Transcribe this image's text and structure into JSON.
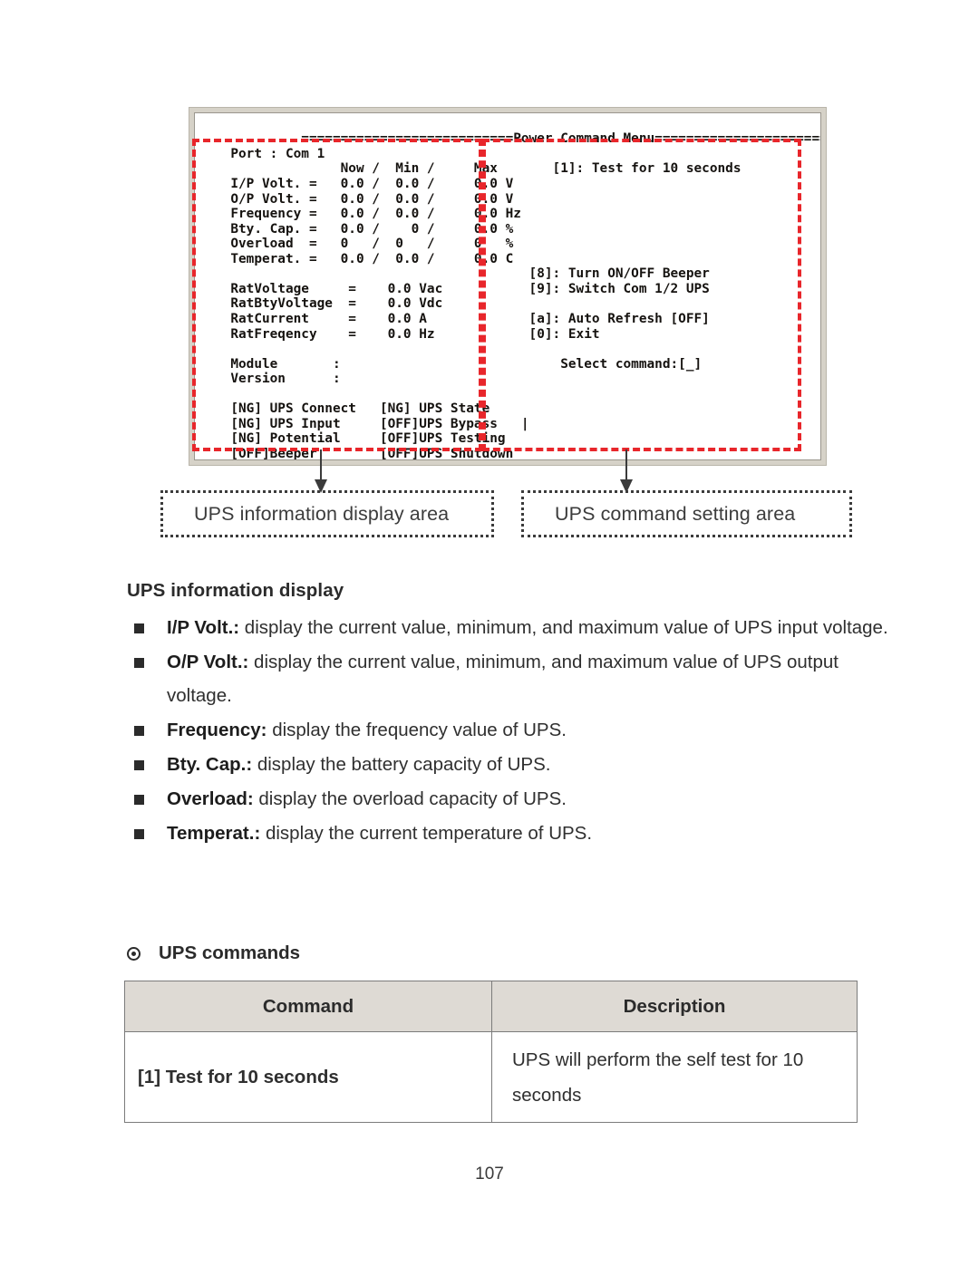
{
  "terminal": {
    "screen_text": "           ===========================Power Command Menu===========================\n  Port : Com 1\n                Now /  Min /     Max       [1]: Test for 10 seconds\n  I/P Volt. =   0.0 /  0.0 /     0.0 V\n  O/P Volt. =   0.0 /  0.0 /     0.0 V\n  Frequency =   0.0 /  0.0 /     0.0 Hz\n  Bty. Cap. =   0.0 /    0 /     0.0 %\n  Overload  =   0   /  0   /     0   %\n  Temperat. =   0.0 /  0.0 /     0.0 C\n                                        [8]: Turn ON/OFF Beeper\n  RatVoltage     =    0.0 Vac           [9]: Switch Com 1/2 UPS\n  RatBtyVoltage  =    0.0 Vdc\n  RatCurrent     =    0.0 A             [a]: Auto Refresh [OFF]\n  RatFreqency    =    0.0 Hz            [0]: Exit\n\n  Module       :                            Select command:[_]\n  Version      :\n\n  [NG] UPS Connect   [NG] UPS State\n  [NG] UPS Input     [OFF]UPS Bypass   |\n  [NG] Potential     [OFF]UPS Testing\n  [OFF]Beeper        [OFF]UPS Shutdown",
    "header_title": "Power Command Menu",
    "port_label": "Port : Com 1",
    "column_headers": [
      "Now",
      "Min",
      "Max"
    ],
    "readings": [
      {
        "label": "I/P Volt.",
        "now": "0.0",
        "min": "0.0",
        "max": "0.0",
        "unit": "V"
      },
      {
        "label": "O/P Volt.",
        "now": "0.0",
        "min": "0.0",
        "max": "0.0",
        "unit": "V"
      },
      {
        "label": "Frequency",
        "now": "0.0",
        "min": "0.0",
        "max": "0.0",
        "unit": "Hz"
      },
      {
        "label": "Bty. Cap.",
        "now": "0.0",
        "min": "0",
        "max": "0.0",
        "unit": "%"
      },
      {
        "label": "Overload",
        "now": "0",
        "min": "0",
        "max": "0",
        "unit": "%"
      },
      {
        "label": "Temperat.",
        "now": "0.0",
        "min": "0.0",
        "max": "0.0",
        "unit": "C"
      }
    ],
    "ratings": [
      {
        "label": "RatVoltage",
        "value": "0.0",
        "unit": "Vac"
      },
      {
        "label": "RatBtyVoltage",
        "value": "0.0",
        "unit": "Vdc"
      },
      {
        "label": "RatCurrent",
        "value": "0.0",
        "unit": "A"
      },
      {
        "label": "RatFreqency",
        "value": "0.0",
        "unit": "Hz"
      }
    ],
    "module_label": "Module",
    "module_value": "",
    "version_label": "Version",
    "version_value": "",
    "status_flags": [
      {
        "state": "[NG]",
        "name": "UPS Connect"
      },
      {
        "state": "[NG]",
        "name": "UPS State"
      },
      {
        "state": "[NG]",
        "name": "UPS Input"
      },
      {
        "state": "[OFF]",
        "name": "UPS Bypass"
      },
      {
        "state": "[NG]",
        "name": "Potential"
      },
      {
        "state": "[OFF]",
        "name": "UPS Testing"
      },
      {
        "state": "[OFF]",
        "name": "Beeper"
      },
      {
        "state": "[OFF]",
        "name": "UPS Shutdown"
      }
    ],
    "menu_items": [
      "[1]: Test for 10 seconds",
      "[8]: Turn ON/OFF Beeper",
      "[9]: Switch Com 1/2 UPS",
      "[a]: Auto Refresh [OFF]",
      "[0]: Exit"
    ],
    "prompt": "Select command:[_]"
  },
  "callouts": {
    "info_area_label": "UPS information display area",
    "command_area_label": "UPS command setting area",
    "accent_color": "#e8262b"
  },
  "info_section": {
    "heading": "UPS information display",
    "bullets": [
      {
        "term": "I/P Volt.:",
        "text": " display the current value, minimum, and maximum value of UPS input voltage."
      },
      {
        "term": "O/P Volt.:",
        "text": " display the current value, minimum, and maximum value of UPS output voltage."
      },
      {
        "term": "Frequency:",
        "text": " display the frequency value of UPS."
      },
      {
        "term": "Bty. Cap.:",
        "text": " display the battery capacity of UPS."
      },
      {
        "term": "Overload:",
        "text": " display the overload capacity of UPS."
      },
      {
        "term": "Temperat.:",
        "text": " display the current temperature of UPS."
      }
    ]
  },
  "commands_section": {
    "heading": "UPS commands",
    "table": {
      "headers": [
        "Command",
        "Description"
      ],
      "rows": [
        {
          "command": "[1] Test for 10 seconds",
          "description": "UPS will perform the self test for 10 seconds"
        }
      ]
    }
  },
  "footer": {
    "page_number": "107"
  }
}
